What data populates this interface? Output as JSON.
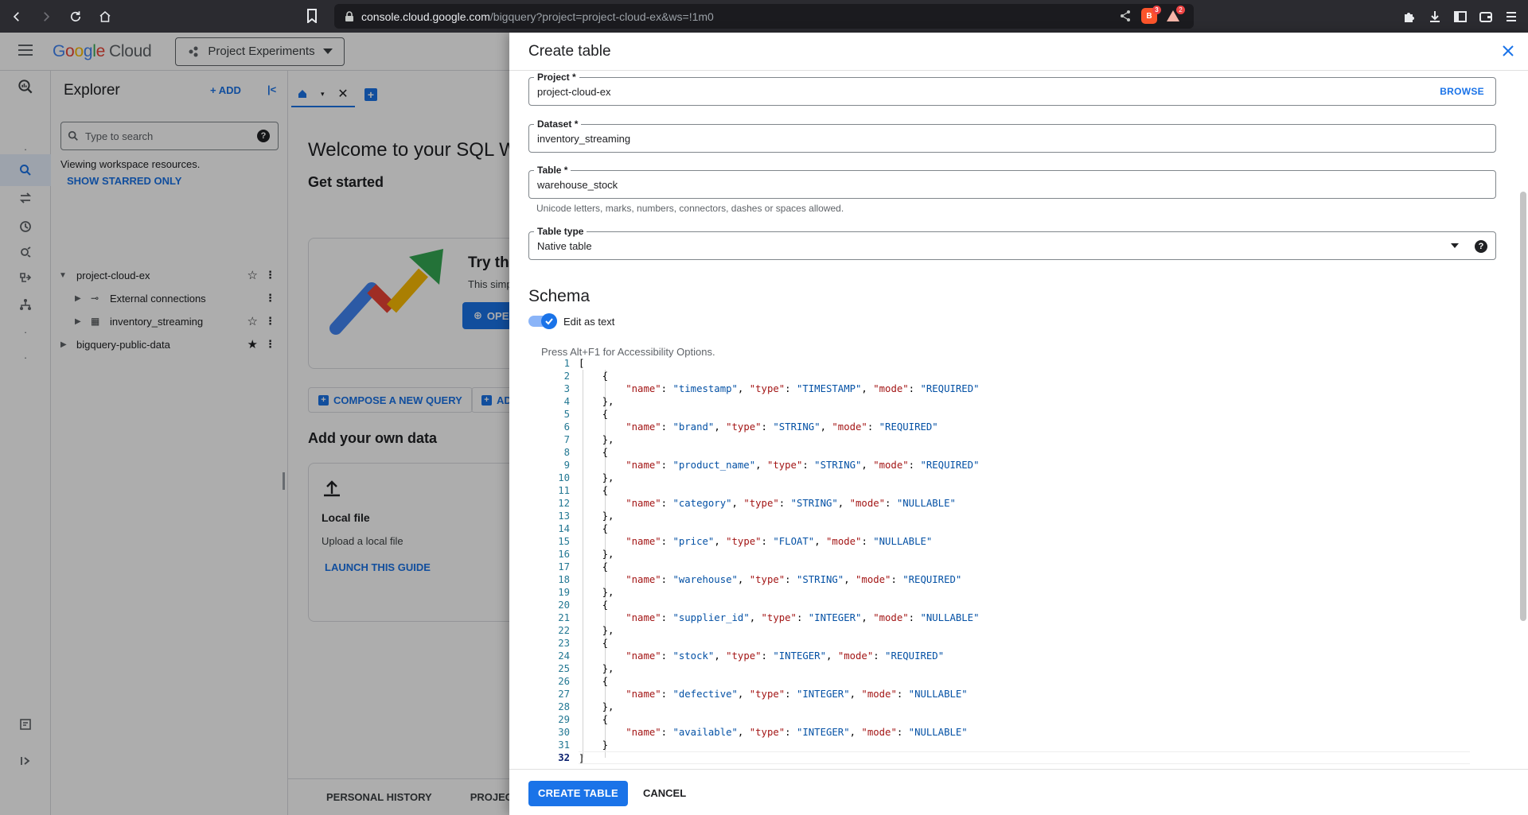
{
  "browser": {
    "url_host": "console.cloud.google.com",
    "url_path": "/bigquery?project=project-cloud-ex&ws=!1m0",
    "brave_badge": "3",
    "alert_badge": "2"
  },
  "console": {
    "brand": {
      "letters": [
        "G",
        "o",
        "o",
        "g",
        "l",
        "e"
      ],
      "suffix": "Cloud"
    },
    "project_picker": "Project Experiments",
    "explorer": {
      "title": "Explorer",
      "add_label": "ADD",
      "search_placeholder": "Type to search",
      "viewing_text": "Viewing workspace resources.",
      "show_starred": "SHOW STARRED ONLY",
      "tree": [
        {
          "label": "project-cloud-ex"
        },
        {
          "label": "External connections"
        },
        {
          "label": "inventory_streaming"
        },
        {
          "label": "bigquery-public-data"
        }
      ]
    },
    "workspace": {
      "welcome": "Welcome to your SQL W",
      "get_started": "Get started",
      "try_title": "Try th",
      "try_text": "This simp",
      "try_btn": "OPE",
      "compose_btn": "COMPOSE A NEW QUERY",
      "compose_btn2": "AD",
      "add_own": "Add your own data",
      "local_title": "Local file",
      "local_desc": "Upload a local file",
      "local_link": "LAUNCH THIS GUIDE",
      "bottom_tabs": [
        "PERSONAL HISTORY",
        "PROJECT"
      ]
    }
  },
  "dialog": {
    "title": "Create table",
    "project": {
      "label": "Project *",
      "value": "project-cloud-ex",
      "browse": "BROWSE"
    },
    "dataset": {
      "label": "Dataset *",
      "value": "inventory_streaming"
    },
    "table": {
      "label": "Table *",
      "value": "warehouse_stock",
      "hint": "Unicode letters, marks, numbers, connectors, dashes or spaces allowed."
    },
    "table_type": {
      "label": "Table type",
      "value": "Native table"
    },
    "schema_title": "Schema",
    "edit_as_text": "Edit as text",
    "edit_as_text_on": true,
    "a11y_hint": "Press Alt+F1 for Accessibility Options.",
    "schema_fields": [
      {
        "name": "timestamp",
        "type": "TIMESTAMP",
        "mode": "REQUIRED"
      },
      {
        "name": "brand",
        "type": "STRING",
        "mode": "REQUIRED"
      },
      {
        "name": "product_name",
        "type": "STRING",
        "mode": "REQUIRED"
      },
      {
        "name": "category",
        "type": "STRING",
        "mode": "NULLABLE"
      },
      {
        "name": "price",
        "type": "FLOAT",
        "mode": "NULLABLE"
      },
      {
        "name": "warehouse",
        "type": "STRING",
        "mode": "REQUIRED"
      },
      {
        "name": "supplier_id",
        "type": "INTEGER",
        "mode": "NULLABLE"
      },
      {
        "name": "stock",
        "type": "INTEGER",
        "mode": "REQUIRED"
      },
      {
        "name": "defective",
        "type": "INTEGER",
        "mode": "NULLABLE"
      },
      {
        "name": "available",
        "type": "INTEGER",
        "mode": "NULLABLE"
      }
    ],
    "create_btn": "CREATE TABLE",
    "cancel_btn": "CANCEL"
  }
}
